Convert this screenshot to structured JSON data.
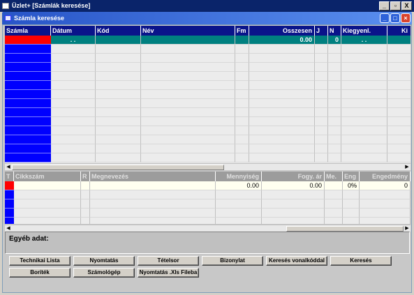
{
  "app": {
    "title": "Üzlet+  [Számlák keresése]",
    "window_buttons": [
      "_",
      "▫",
      "X"
    ]
  },
  "inner": {
    "title": "Számla keresése"
  },
  "top_grid": {
    "headers": [
      "Számla",
      "Dátum",
      "Kód",
      "Név",
      "Fm",
      "Osszesen",
      "J",
      "N",
      "Kiegyenl.",
      "Ki"
    ],
    "first_row": {
      "datum": ". .",
      "osszesen": "0.00",
      "n": "0",
      "kiegyenl": ". ."
    }
  },
  "bottom_grid": {
    "headers": [
      "T",
      "Cikkszám",
      "R",
      "Megnevezés",
      "Mennyiség",
      "Fogy. ár",
      "Me.",
      "Eng",
      "Engedmény"
    ],
    "first_row": {
      "mennyiseg": "0.00",
      "fogy_ar": "0.00",
      "eng": "0%",
      "engedmeny": "0"
    }
  },
  "egyeb": {
    "label": "Egyéb adat:"
  },
  "buttons": {
    "row1": [
      "Technikai Lista",
      "Nyomtatás",
      "Tételsor",
      "Bizonylat",
      "Keresés vonalkóddal",
      "Keresés"
    ],
    "row2": [
      "Boríték",
      "Számológép",
      "Nyomtatás .Xls Fileba"
    ]
  },
  "colors": {
    "header_blue": "#0a148a",
    "indicator_blue": "#0000ff",
    "selected_red": "#ff0000",
    "active_row_teal": "#008080"
  }
}
